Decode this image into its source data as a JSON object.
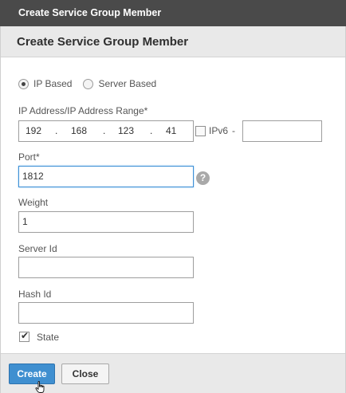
{
  "window": {
    "title": "Create Service Group Member"
  },
  "dialog": {
    "header": "Create Service Group Member",
    "radios": [
      {
        "label": "IP Based",
        "checked": true
      },
      {
        "label": "Server Based",
        "checked": false
      }
    ],
    "ip_address": {
      "label": "IP Address/IP Address Range*",
      "octets": [
        "192",
        "168",
        "123",
        "41"
      ],
      "ipv6_label": "IPv6",
      "ipv6_checked": false,
      "range_separator": "-",
      "range_end_value": ""
    },
    "port": {
      "label": "Port*",
      "value": "1812",
      "help_icon": "?"
    },
    "weight": {
      "label": "Weight",
      "value": "1"
    },
    "server_id": {
      "label": "Server Id",
      "value": ""
    },
    "hash_id": {
      "label": "Hash Id",
      "value": ""
    },
    "state": {
      "label": "State",
      "checked": true
    }
  },
  "footer": {
    "create_label": "Create",
    "close_label": "Close"
  },
  "colors": {
    "primary": "#3f8fd0",
    "titlebar": "#4a4a4a",
    "panel": "#e9e9e9",
    "focus": "#3d8fd6"
  }
}
